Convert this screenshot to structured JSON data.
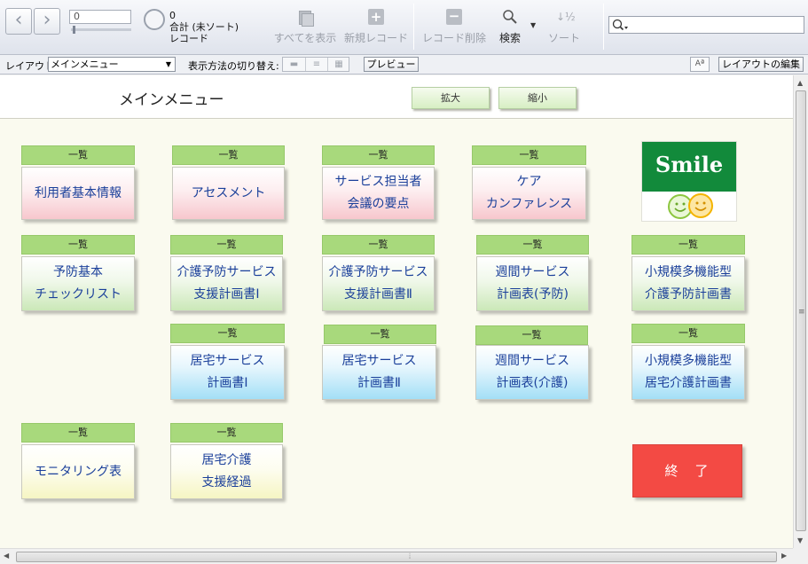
{
  "toolbar": {
    "back_icon": "chevron-left",
    "forward_icon": "chevron-right",
    "record_number": "0",
    "record_count": "0",
    "found_status": "合計 (未ソート)",
    "record_word": "レコード",
    "show_all": "すべてを表示",
    "new_record": "新規レコード",
    "delete_record": "レコード削除",
    "search": "検索",
    "sort": "ソート",
    "quickfind_value": "",
    "quickfind_icon": "magnifier-icon"
  },
  "layout_bar": {
    "layout_label": "レイアウト:",
    "layout_value": "メインメニュー",
    "view_as_label": "表示方法の切り替え:",
    "preview": "プレビュー",
    "text_format_label": "Aª",
    "edit_layout": "レイアウトの編集"
  },
  "main": {
    "title": "メインメニュー",
    "zoom_in": "拡大",
    "zoom_out": "縮小",
    "list_label": "一覧",
    "end_button": "終　了",
    "logo_text": "Smile",
    "colors": {
      "list_bar": "#a8d97c",
      "end_button": "#f34a44",
      "logo_green": "#128a3b",
      "button_text": "#1a3f9a"
    },
    "buttons": {
      "riyousha": [
        "利用者基本情報"
      ],
      "assessment": [
        "アセスメント"
      ],
      "service_meeting": [
        "サービス担当者",
        "会議の要点"
      ],
      "care_conference": [
        "ケア",
        "カンファレンス"
      ],
      "yobou_checklist": [
        "予防基本",
        "チェックリスト"
      ],
      "kaigo_yobou_1": [
        "介護予防サービス",
        "支援計画書Ⅰ"
      ],
      "kaigo_yobou_2": [
        "介護予防サービス",
        "支援計画書Ⅱ"
      ],
      "weekly_yobou": [
        "週間サービス",
        "計画表(予防)"
      ],
      "shoukibo_yobou": [
        "小規模多機能型",
        "介護予防計画書"
      ],
      "kyotaku_1": [
        "居宅サービス",
        "計画書Ⅰ"
      ],
      "kyotaku_2": [
        "居宅サービス",
        "計画書Ⅱ"
      ],
      "weekly_kaigo": [
        "週間サービス",
        "計画表(介護)"
      ],
      "shoukibo_kyotaku": [
        "小規模多機能型",
        "居宅介護計画書"
      ],
      "monitoring": [
        "モニタリング表"
      ],
      "kyotaku_keika": [
        "居宅介護",
        "支援経過"
      ]
    }
  }
}
